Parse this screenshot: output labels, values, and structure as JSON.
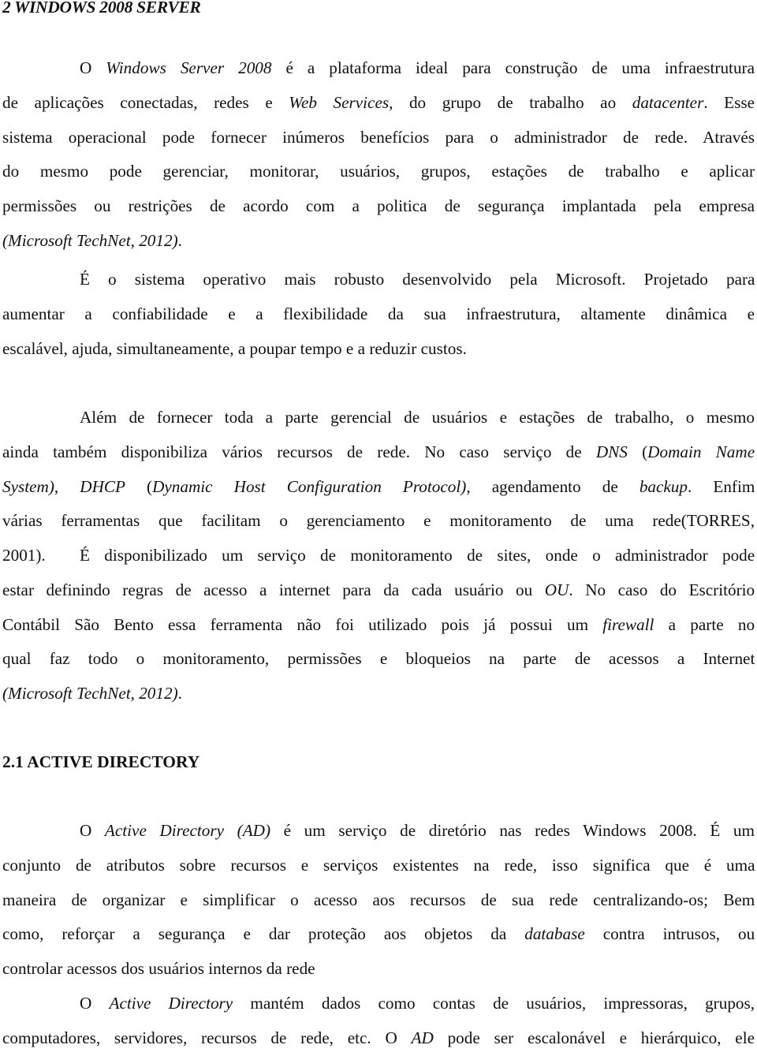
{
  "document": {
    "section_heading": "2 WINDOWS 2008 SERVER",
    "subsection_heading": "2.1 ACTIVE DIRECTORY",
    "paragraphs": [
      {
        "lines": [
          [
            {
              "t": "O "
            },
            {
              "t": "Windows Server 2008",
              "i": true
            },
            {
              "t": " é a plataforma ideal para construção de uma infraestrutura"
            }
          ],
          [
            {
              "t": "de aplicações conectadas, redes e "
            },
            {
              "t": "Web Services",
              "i": true
            },
            {
              "t": ", do grupo de trabalho ao "
            },
            {
              "t": "datacenter",
              "i": true
            },
            {
              "t": ". Esse"
            }
          ],
          [
            {
              "t": "sistema operacional pode fornecer inúmeros benefícios para o administrador de rede. Através"
            }
          ],
          [
            {
              "t": "do mesmo pode gerenciar, monitorar, usuários, grupos, estações de trabalho e aplicar"
            }
          ],
          [
            {
              "t": "permissões ou restrições de acordo com a politica de segurança implantada pela empresa"
            }
          ],
          [
            {
              "t": "(Microsoft TechNet, 2012)",
              "i": true
            },
            {
              "t": "."
            }
          ]
        ]
      },
      {
        "lines": [
          [
            {
              "t": "É o sistema operativo mais robusto desenvolvido pela Microsoft. Projetado para"
            }
          ],
          [
            {
              "t": "aumentar a confiabilidade e a flexibilidade da sua infraestrutura, altamente dinâmica e"
            }
          ],
          [
            {
              "t": "escalável, ajuda, simultaneamente, a poupar tempo e a reduzir custos."
            }
          ]
        ]
      },
      {
        "lines": [
          [
            {
              "t": "Além de fornecer toda a parte gerencial de usuários e estações de trabalho, o mesmo"
            }
          ],
          [
            {
              "t": "ainda também disponibiliza vários recursos de rede. No caso serviço de "
            },
            {
              "t": "DNS",
              "i": true
            },
            {
              "t": " ("
            },
            {
              "t": "Domain Name",
              "i": true
            }
          ],
          [
            {
              "t": "System)",
              "i": true
            },
            {
              "t": ", "
            },
            {
              "t": "DHCP",
              "i": true
            },
            {
              "t": " ("
            },
            {
              "t": "Dynamic Host Configuration Protocol)",
              "i": true
            },
            {
              "t": ", agendamento de "
            },
            {
              "t": "backup",
              "i": true
            },
            {
              "t": ". Enfim"
            }
          ],
          [
            {
              "t": "várias ferramentas que facilitam o gerenciamento e monitoramento de uma rede(TORRES,"
            }
          ],
          [
            {
              "t": "2001)."
            }
          ]
        ]
      },
      {
        "lines": [
          [
            {
              "t": "É disponibilizado um serviço de monitoramento de sites, onde o administrador pode"
            }
          ],
          [
            {
              "t": "estar definindo regras de acesso a internet para da cada usuário ou "
            },
            {
              "t": "OU",
              "i": true
            },
            {
              "t": ". No caso do Escritório"
            }
          ],
          [
            {
              "t": "Contábil São Bento essa ferramenta não foi utilizado pois já possui um "
            },
            {
              "t": "firewall",
              "i": true
            },
            {
              "t": " a parte no"
            }
          ],
          [
            {
              "t": "qual faz todo o monitoramento, permissões e bloqueios na parte de acessos a Internet"
            }
          ],
          [
            {
              "t": "(Microsoft TechNet, 2012)",
              "i": true
            },
            {
              "t": "."
            }
          ]
        ]
      },
      {
        "lines": [
          [
            {
              "t": "O "
            },
            {
              "t": "Active Directory (AD)",
              "i": true
            },
            {
              "t": " é um serviço de diretório nas redes Windows 2008. É um"
            }
          ],
          [
            {
              "t": "conjunto de atributos sobre recursos e serviços existentes na rede, isso significa que é uma"
            }
          ],
          [
            {
              "t": "maneira de organizar e simplificar o acesso aos recursos de sua rede centralizando-os; Bem"
            }
          ],
          [
            {
              "t": "como, reforçar a segurança e dar proteção aos objetos da "
            },
            {
              "t": "database",
              "i": true
            },
            {
              "t": " contra intrusos, ou"
            }
          ],
          [
            {
              "t": "controlar acessos dos usuários internos da rede"
            }
          ]
        ]
      },
      {
        "lines": [
          [
            {
              "t": "O "
            },
            {
              "t": "Active Directory",
              "i": true
            },
            {
              "t": " mantém dados como contas de usuários, impressoras, grupos,"
            }
          ],
          [
            {
              "t": "computadores, servidores, recursos de rede, etc. O "
            },
            {
              "t": "AD",
              "i": true
            },
            {
              "t": " pode ser escalonável e hierárquico, ele"
            }
          ]
        ]
      }
    ]
  }
}
